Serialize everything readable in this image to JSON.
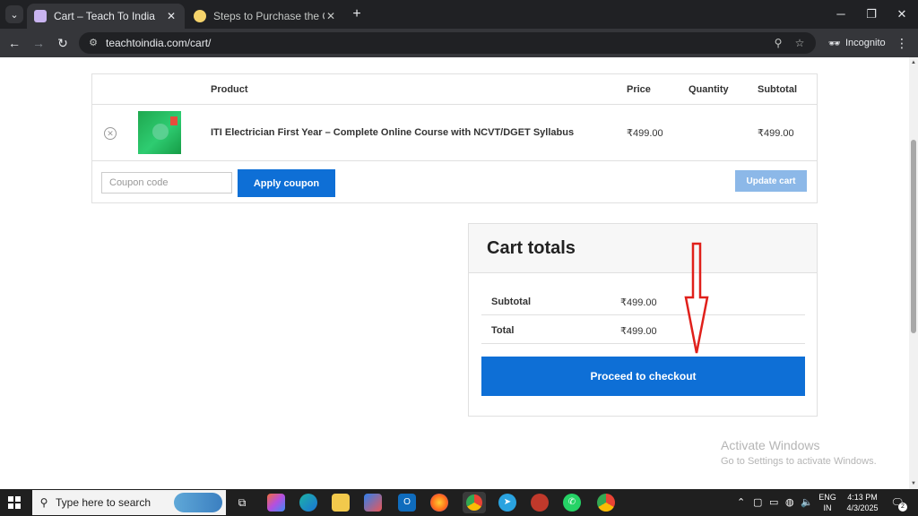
{
  "browser": {
    "tabs": [
      {
        "title": "Cart – Teach To India",
        "favicon_color": "#c9b4f0"
      },
      {
        "title": "Steps to Purchase the Course -",
        "favicon_color": "#f5d36b"
      }
    ],
    "url": "teachtoindia.com/cart/",
    "incognito_label": "Incognito"
  },
  "cart": {
    "headers": {
      "product": "Product",
      "price": "Price",
      "quantity": "Quantity",
      "subtotal": "Subtotal"
    },
    "items": [
      {
        "name": "ITI Electrician First Year – Complete Online Course with NCVT/DGET Syllabus",
        "price": "₹499.00",
        "subtotal": "₹499.00"
      }
    ],
    "coupon_placeholder": "Coupon code",
    "apply_coupon_label": "Apply coupon",
    "update_cart_label": "Update cart"
  },
  "totals": {
    "title": "Cart totals",
    "subtotal_label": "Subtotal",
    "subtotal_value": "₹499.00",
    "total_label": "Total",
    "total_value": "₹499.00",
    "checkout_label": "Proceed to checkout"
  },
  "watermark": {
    "line1": "Activate Windows",
    "line2": "Go to Settings to activate Windows."
  },
  "taskbar": {
    "search_placeholder": "Type here to search",
    "lang_line1": "ENG",
    "lang_line2": "IN",
    "time": "4:13 PM",
    "date": "4/3/2025",
    "notification_count": "2"
  },
  "colors": {
    "accent_blue": "#0e6fd6",
    "disabled_blue": "#8cb8e8",
    "arrow_red": "#e0201b"
  }
}
